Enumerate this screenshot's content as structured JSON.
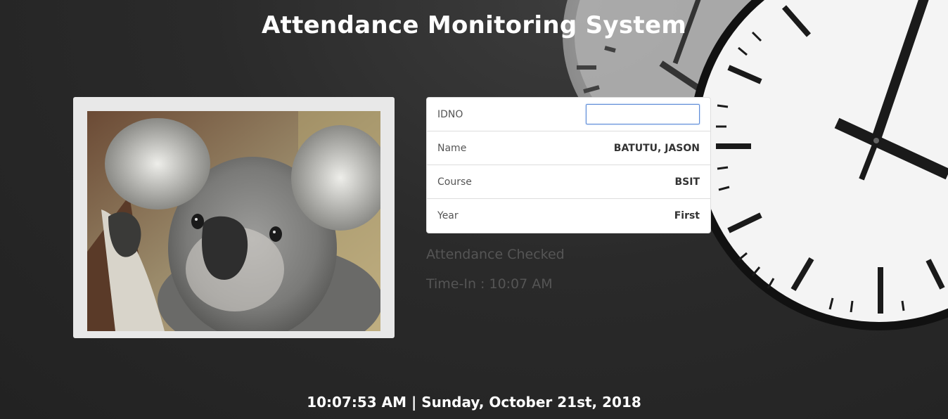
{
  "app": {
    "title": "Attendance Monitoring System"
  },
  "photo": {
    "subject": "koala"
  },
  "record": {
    "idno_label": "IDNO",
    "idno_value": "",
    "name_label": "Name",
    "name_value": "BATUTU, JASON",
    "course_label": "Course",
    "course_value": "BSIT",
    "year_label": "Year",
    "year_value": "First"
  },
  "status": {
    "message": "Attendance Checked",
    "time_in": "Time-In : 10:07 AM"
  },
  "footer": {
    "datetime": "10:07:53 AM | Sunday, October 21st, 2018"
  },
  "colors": {
    "background": "#2a2a2a",
    "frame": "#e8e8e8",
    "input_focus": "#5b8ad6"
  }
}
